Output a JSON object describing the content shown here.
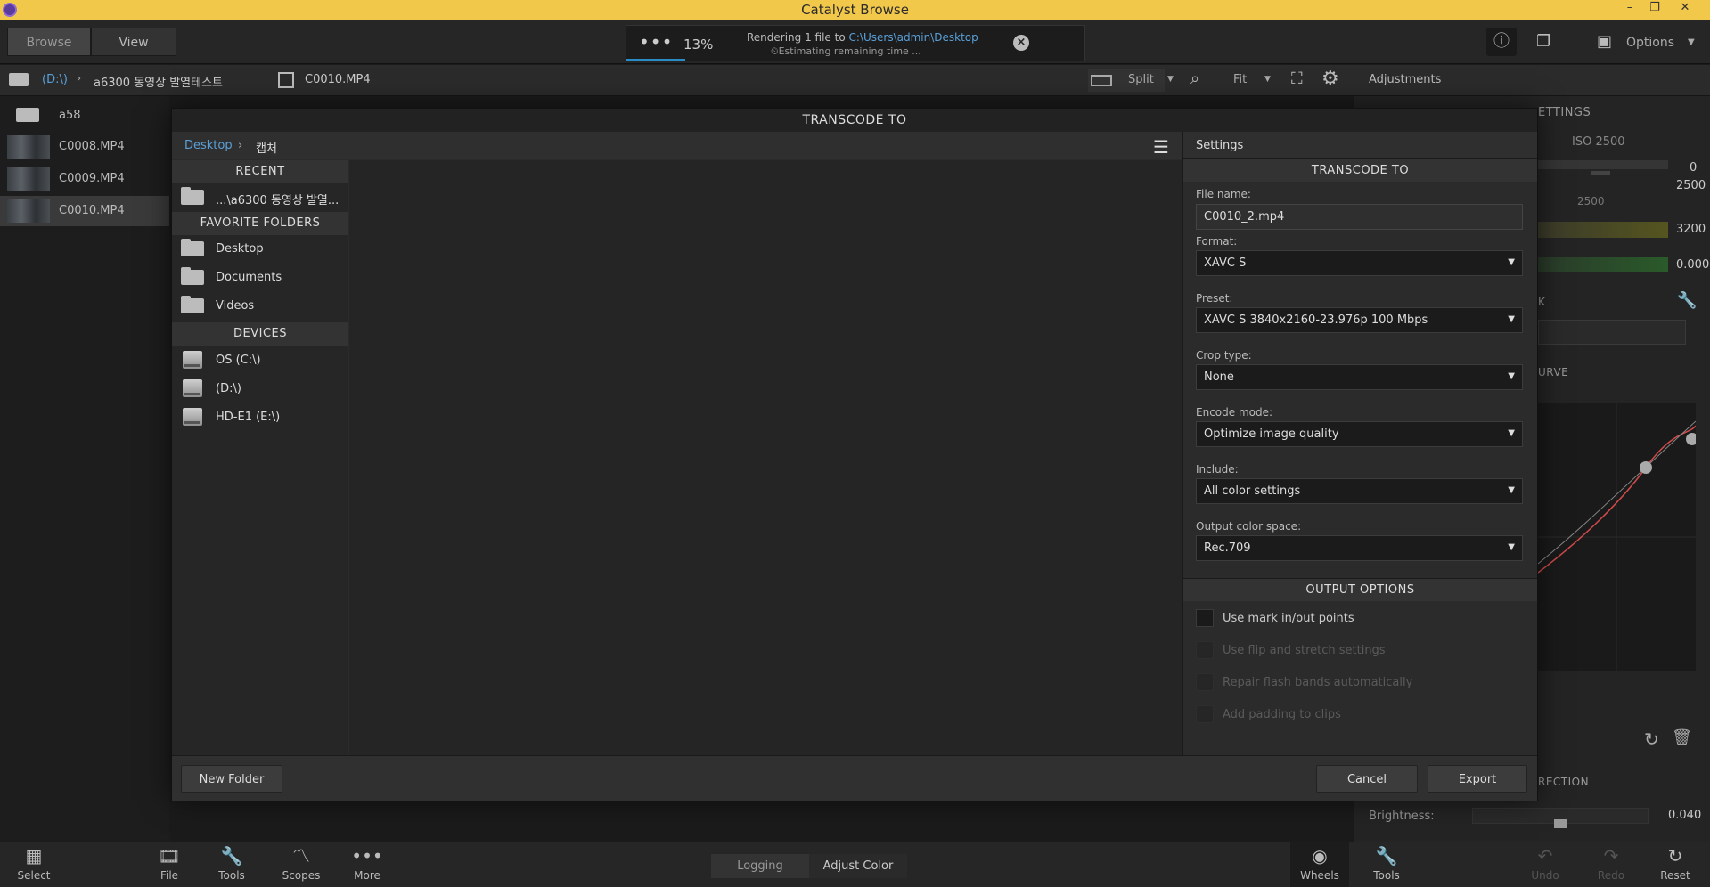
{
  "window": {
    "title": "Catalyst Browse"
  },
  "toolbar": {
    "browse_label": "Browse",
    "view_label": "View",
    "render": {
      "progress_label": "13%",
      "progress_percent": 13,
      "message_prefix": "Rendering 1 file to",
      "message_path": "C:\\Users\\admin\\Desktop",
      "eta": "Estimating remaining time ..."
    },
    "options_label": "Options"
  },
  "pathbar": {
    "drive": "(D:\\)",
    "folder": "a6300 동영상 발열테스트"
  },
  "viewer": {
    "clip_name": "C0010.MP4",
    "split_label": "Split",
    "fit_label": "Fit"
  },
  "adjustments": {
    "title": "Adjustments",
    "settings_fragment": "ETTINGS",
    "iso_label": "ISO 2500",
    "values": [
      "0",
      "2500",
      "3200",
      "0.000"
    ],
    "sub_value": "2500",
    "k_fragment": "K",
    "curve_fragment": "URVE",
    "correction_fragment": "RECTION",
    "brightness_label": "Brightness:",
    "brightness_value": "0.040"
  },
  "clips": [
    {
      "name": "a58",
      "type": "folder"
    },
    {
      "name": "C0008.MP4",
      "type": "clip"
    },
    {
      "name": "C0009.MP4",
      "type": "clip"
    },
    {
      "name": "C0010.MP4",
      "type": "clip",
      "selected": true
    }
  ],
  "bottombar": {
    "select": "Select",
    "file": "File",
    "tools": "Tools",
    "scopes": "Scopes",
    "more": "More",
    "logging": "Logging",
    "adjust_color": "Adjust Color",
    "wheels": "Wheels",
    "tools_right": "Tools",
    "undo": "Undo",
    "redo": "Redo",
    "reset": "Reset"
  },
  "dialog": {
    "title": "TRANSCODE TO",
    "breadcrumb": [
      "Desktop",
      "캡처"
    ],
    "recent_header": "RECENT",
    "recent_items": [
      "...\\a6300 동영상 발열..."
    ],
    "favorites_header": "FAVORITE FOLDERS",
    "favorites": [
      "Desktop",
      "Documents",
      "Videos"
    ],
    "devices_header": "DEVICES",
    "devices": [
      "OS (C:\\)",
      "(D:\\)",
      "HD-E1 (E:\\)"
    ],
    "settings": {
      "header": "Settings",
      "section_title": "TRANSCODE TO",
      "file_name_label": "File name:",
      "file_name_value": "C0010_2.mp4",
      "format_label": "Format:",
      "format_value": "XAVC S",
      "preset_label": "Preset:",
      "preset_value": "XAVC S 3840x2160-23.976p 100 Mbps",
      "crop_label": "Crop type:",
      "crop_value": "None",
      "encode_label": "Encode mode:",
      "encode_value": "Optimize image quality",
      "include_label": "Include:",
      "include_value": "All color settings",
      "color_space_label": "Output color space:",
      "color_space_value": "Rec.709",
      "output_options_title": "OUTPUT OPTIONS",
      "options": [
        {
          "label": "Use mark in/out points",
          "enabled": true
        },
        {
          "label": "Use flip and stretch settings",
          "enabled": false
        },
        {
          "label": "Repair flash bands automatically",
          "enabled": false
        },
        {
          "label": "Add padding to clips",
          "enabled": false
        }
      ]
    },
    "new_folder_label": "New Folder",
    "cancel_label": "Cancel",
    "export_label": "Export"
  },
  "colors": {
    "titlebar": "#f2c84b",
    "accent_blue": "#5aa0d8",
    "progress": "#2a8cc4",
    "curve_red": "#d04a4a"
  }
}
